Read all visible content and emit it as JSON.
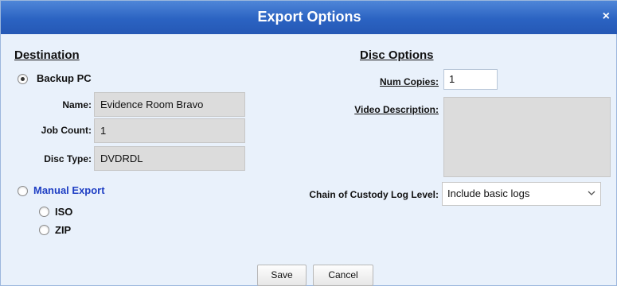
{
  "dialog": {
    "title": "Export Options",
    "close_glyph": "×"
  },
  "destination": {
    "heading": "Destination",
    "backup_pc_label": "Backup PC",
    "backup_pc_selected": true,
    "name_label": "Name:",
    "name_value": "Evidence Room Bravo",
    "job_count_label": "Job Count:",
    "job_count_value": "1",
    "disc_type_label": "Disc Type:",
    "disc_type_value": "DVDRDL",
    "manual_export_label": "Manual Export",
    "manual_export_selected": false,
    "iso_label": "ISO",
    "zip_label": "ZIP"
  },
  "disc_options": {
    "heading": "Disc Options",
    "num_copies_label": "Num Copies:",
    "num_copies_value": "1",
    "video_description_label": "Video Description:",
    "video_description_value": "",
    "chain_label": "Chain of Custody Log Level:",
    "chain_value": "Include basic logs"
  },
  "buttons": {
    "save": "Save",
    "cancel": "Cancel"
  },
  "icons": {
    "close": "close-icon",
    "dropdown": "chevron-down-icon"
  }
}
